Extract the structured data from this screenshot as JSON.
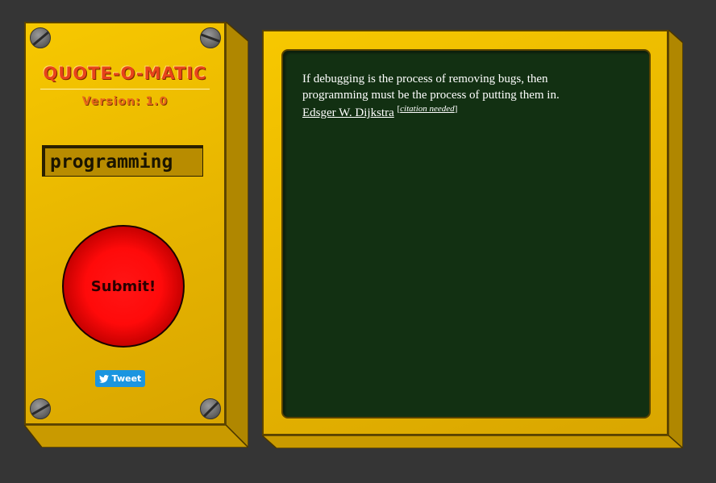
{
  "app": {
    "title": "QUOTE-O-MATIC",
    "version": "Version: 1.0"
  },
  "search": {
    "value": "programming"
  },
  "submit": {
    "label": "Submit!"
  },
  "tweet": {
    "label": "Tweet",
    "icon": "twitter-bird-icon"
  },
  "quote": {
    "text": "If debugging is the process of removing bugs, then programming must be the process of putting them in.",
    "author": "Edsger W. Dijkstra",
    "citation_open": "[",
    "citation_label": "citation needed",
    "citation_close": "]"
  },
  "colors": {
    "background": "#353535",
    "panel_yellow": "#f7c800",
    "screen_green": "#123012",
    "button_red": "#ff1515",
    "title_orange": "#e8441a",
    "tweet_blue": "#1b95e0"
  }
}
